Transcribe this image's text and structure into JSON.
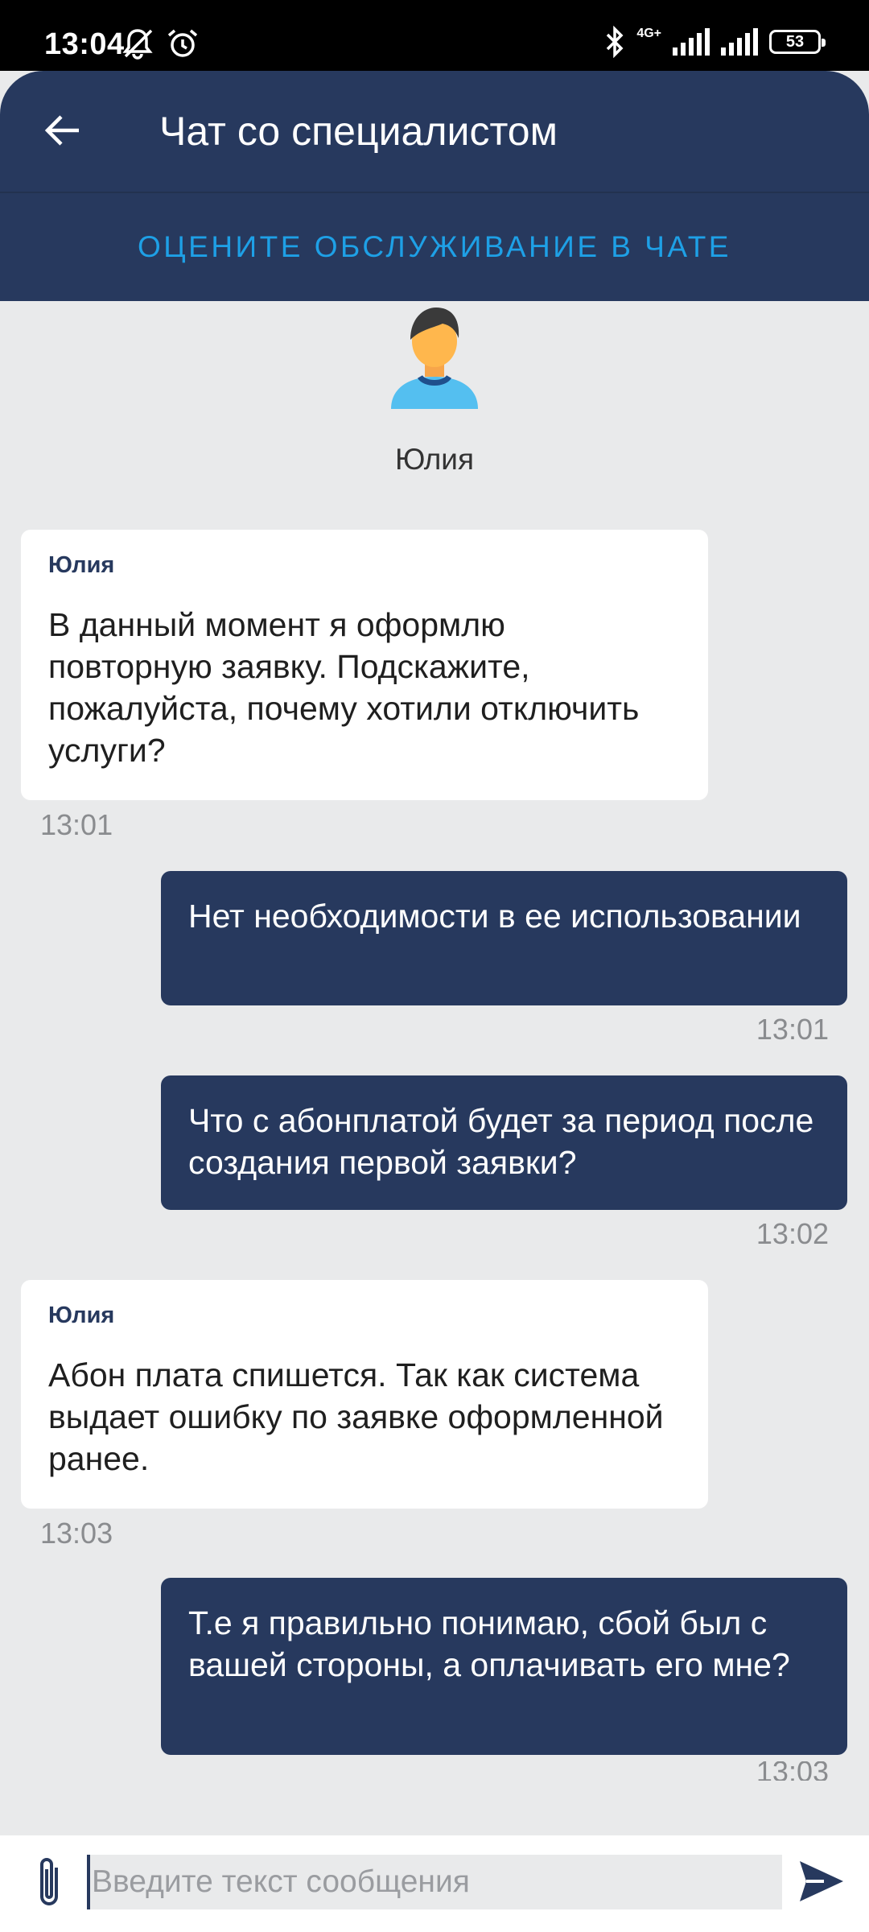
{
  "status_bar": {
    "time": "13:04",
    "network": "4G+",
    "battery": "53",
    "icons": [
      "notifications-off-icon",
      "alarm-icon",
      "bluetooth-icon",
      "signal-icon",
      "signal-icon",
      "battery-icon"
    ]
  },
  "header": {
    "title": "Чат со специалистом",
    "back_icon": "arrow-left-icon",
    "rate_link": "ОЦЕНИТЕ ОБСЛУЖИВАНИЕ В ЧАТЕ"
  },
  "agent": {
    "name": "Юлия",
    "avatar_icon": "person-avatar-icon"
  },
  "messages": [
    {
      "direction": "incoming",
      "sender": "Юлия",
      "text": "В данный момент я оформлю повторную заявку. Подскажите, пожалуйста, почему хотили отключить услуги?",
      "time": "13:01"
    },
    {
      "direction": "outgoing",
      "text": "Нет необходимости в ее использовании",
      "time": "13:01"
    },
    {
      "direction": "outgoing",
      "text": "Что с абонплатой будет за период после создания первой заявки?",
      "time": "13:02"
    },
    {
      "direction": "incoming",
      "sender": "Юлия",
      "text": "Абон плата спишется. Так как система выдает ошибку по заявке оформленной ранее.",
      "time": "13:03"
    },
    {
      "direction": "outgoing",
      "text": "Т.е я правильно понимаю, сбой был с вашей стороны, а оплачивать его мне?",
      "time": "13:03"
    }
  ],
  "composer": {
    "placeholder": "Введите текст сообщения",
    "value": "",
    "attach_icon": "paperclip-icon",
    "send_icon": "send-icon"
  },
  "colors": {
    "primary": "#27395e",
    "accent": "#1ea0e6",
    "background": "#e9eaeb",
    "incoming_bubble": "#ffffff",
    "timestamp": "#8a8c8f"
  }
}
